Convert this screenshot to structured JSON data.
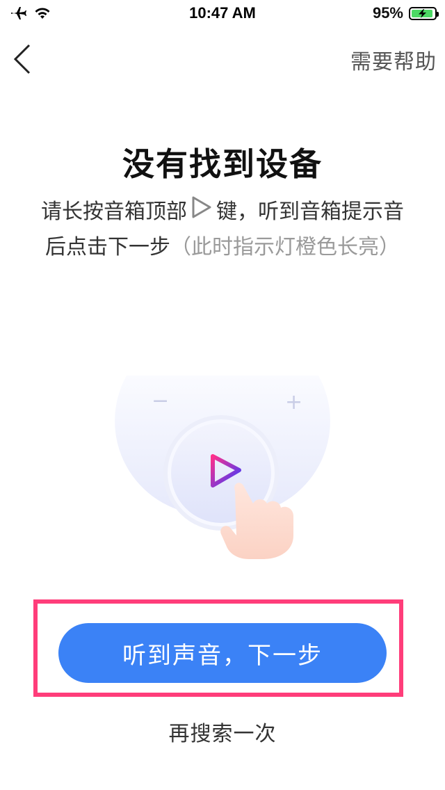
{
  "status_bar": {
    "time": "10:47 AM",
    "battery_percent_text": "95%",
    "battery_level": 0.95,
    "icons": [
      "airplane-icon",
      "wifi-icon",
      "battery-charging-icon"
    ]
  },
  "nav": {
    "back_icon": "chevron-left-icon",
    "help_label": "需要帮助"
  },
  "content": {
    "title": "没有找到设备",
    "instruction_part1": "请长按音箱顶部",
    "instruction_part2": "键，听到音箱提示音",
    "instruction_part3": "后点击下一步",
    "instruction_hint": "（此时指示灯橙色长亮）",
    "illustration": {
      "minus_symbol": "−",
      "plus_symbol": "+",
      "icons": [
        "speaker-top-illustration",
        "play-icon",
        "hand-pointer-icon"
      ]
    }
  },
  "actions": {
    "primary_label": "听到声音，下一步",
    "secondary_label": "再搜索一次"
  },
  "colors": {
    "primary": "#3b82f6",
    "highlight": "#ff3d7a",
    "battery": "#4cd964"
  }
}
